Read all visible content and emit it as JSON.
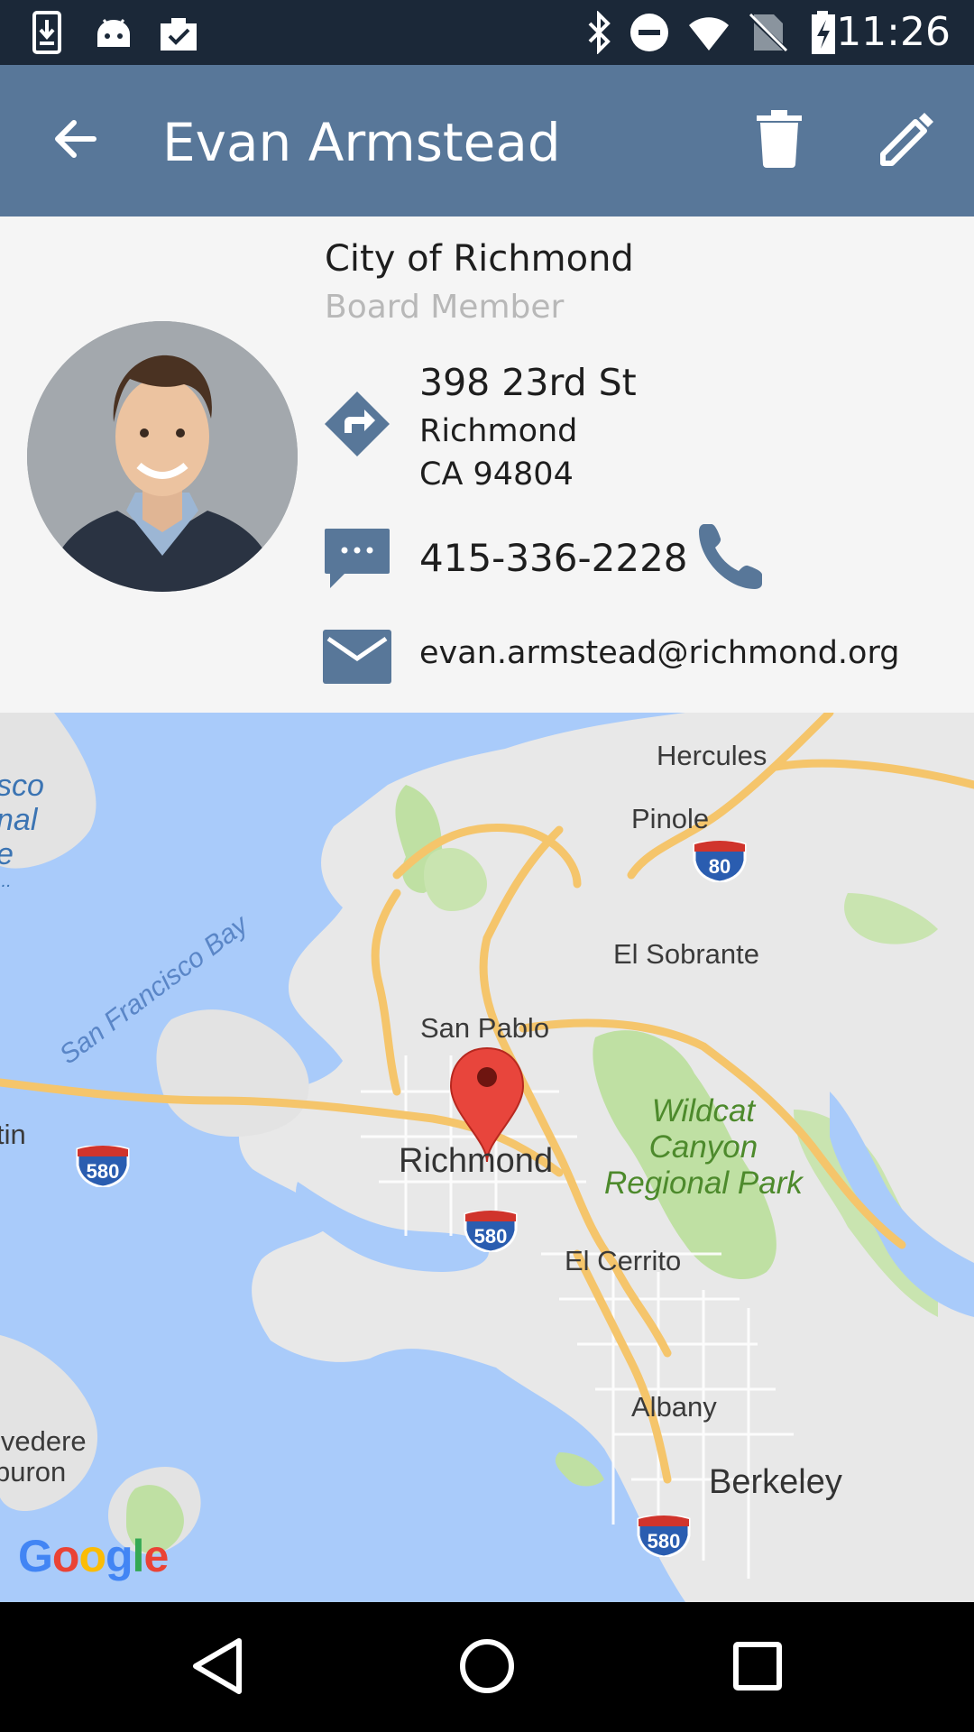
{
  "status_bar": {
    "time": "11:26",
    "left_icons": [
      "download-icon",
      "android-icon",
      "clipboard-check-icon"
    ],
    "right_icons": [
      "bluetooth-icon",
      "do-not-disturb-icon",
      "wifi-icon",
      "no-sim-icon",
      "battery-charging-icon"
    ]
  },
  "app_bar": {
    "title": "Evan Armstead",
    "back_icon": "arrow-back-icon",
    "delete_icon": "trash-icon",
    "edit_icon": "pencil-icon"
  },
  "contact": {
    "organization": "City of Richmond",
    "role": "Board Member",
    "address": {
      "line1": "398 23rd St",
      "line2": "Richmond",
      "line3": "CA 94804"
    },
    "phone": "415-336-2228",
    "email": "evan.armstead@richmond.org"
  },
  "map": {
    "labels": {
      "hercules": "Hercules",
      "pinole": "Pinole",
      "el_sobrante": "El Sobrante",
      "san_pablo": "San Pablo",
      "richmond": "Richmond",
      "el_cerrito": "El Cerrito",
      "albany": "Albany",
      "berkeley": "Berkeley",
      "wildcat_1": "Wildcat",
      "wildcat_2": "Canyon",
      "wildcat_3": "Regional Park",
      "bay": "San Francisco Bay",
      "edge_sco": "sco",
      "edge_nal": "nal",
      "edge_e": "e",
      "edge_dots": "...",
      "edge_tin": "tin",
      "belvedere": "lvedere",
      "tiburon": "buron"
    },
    "shields": {
      "i80": "80",
      "i580_west": "580",
      "i580_center": "580",
      "i580_south": "580"
    },
    "attribution": "Google"
  },
  "colors": {
    "app_bar": "#587799",
    "status_bar": "#1b2838",
    "accent_icon": "#587799",
    "map_water": "#a9cbfa",
    "map_land": "#e8e8e8",
    "park": "#bfe0a3",
    "highway": "#f5c56b"
  }
}
